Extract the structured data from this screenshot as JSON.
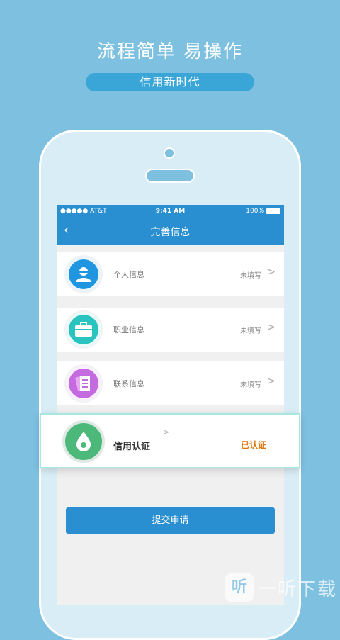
{
  "promo": {
    "headline": "流程简单  易操作",
    "pill": "信用新时代"
  },
  "statusbar": {
    "carrier": "●●●●● AT&T",
    "time": "9:41 AM",
    "battery": "100%"
  },
  "navbar": {
    "back_icon": "‹",
    "title": "完善信息"
  },
  "rows": [
    {
      "label": "个人信息",
      "status": "未填写",
      "icon": "person-icon",
      "color": "#2196e0"
    },
    {
      "label": "职业信息",
      "status": "未填写",
      "icon": "briefcase-icon",
      "color": "#29c4c0"
    },
    {
      "label": "联系信息",
      "status": "未填写",
      "icon": "contact-book-icon",
      "color": "#c46be0"
    }
  ],
  "credit_card": {
    "label": "信用认证",
    "status": "已认证",
    "icon": "drop-icon",
    "color": "#4cb87a"
  },
  "submit_label": "提交申请",
  "watermark": {
    "logo": "听",
    "text": "一听下载"
  }
}
